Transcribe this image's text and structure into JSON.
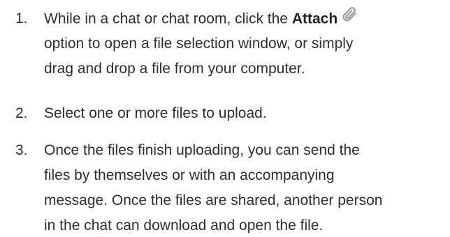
{
  "steps": [
    {
      "number": "1.",
      "line1_prefix": "While in a chat or chat room, click the ",
      "line1_bold": "Attach",
      "icon": "paperclip-icon",
      "line2": "option to open a file selection window, or simply",
      "line3": "drag and drop a file from your computer."
    },
    {
      "number": "2.",
      "line1": "Select one or more files to upload."
    },
    {
      "number": "3.",
      "line1": "Once the files finish uploading, you can send the",
      "line2": "files by themselves or with an accompanying",
      "line3": "message. Once the files are shared, another person",
      "line4": "in the chat can download and open the file."
    }
  ],
  "colors": {
    "text": "#2e2e2e",
    "icon": "#9a9a9a"
  }
}
